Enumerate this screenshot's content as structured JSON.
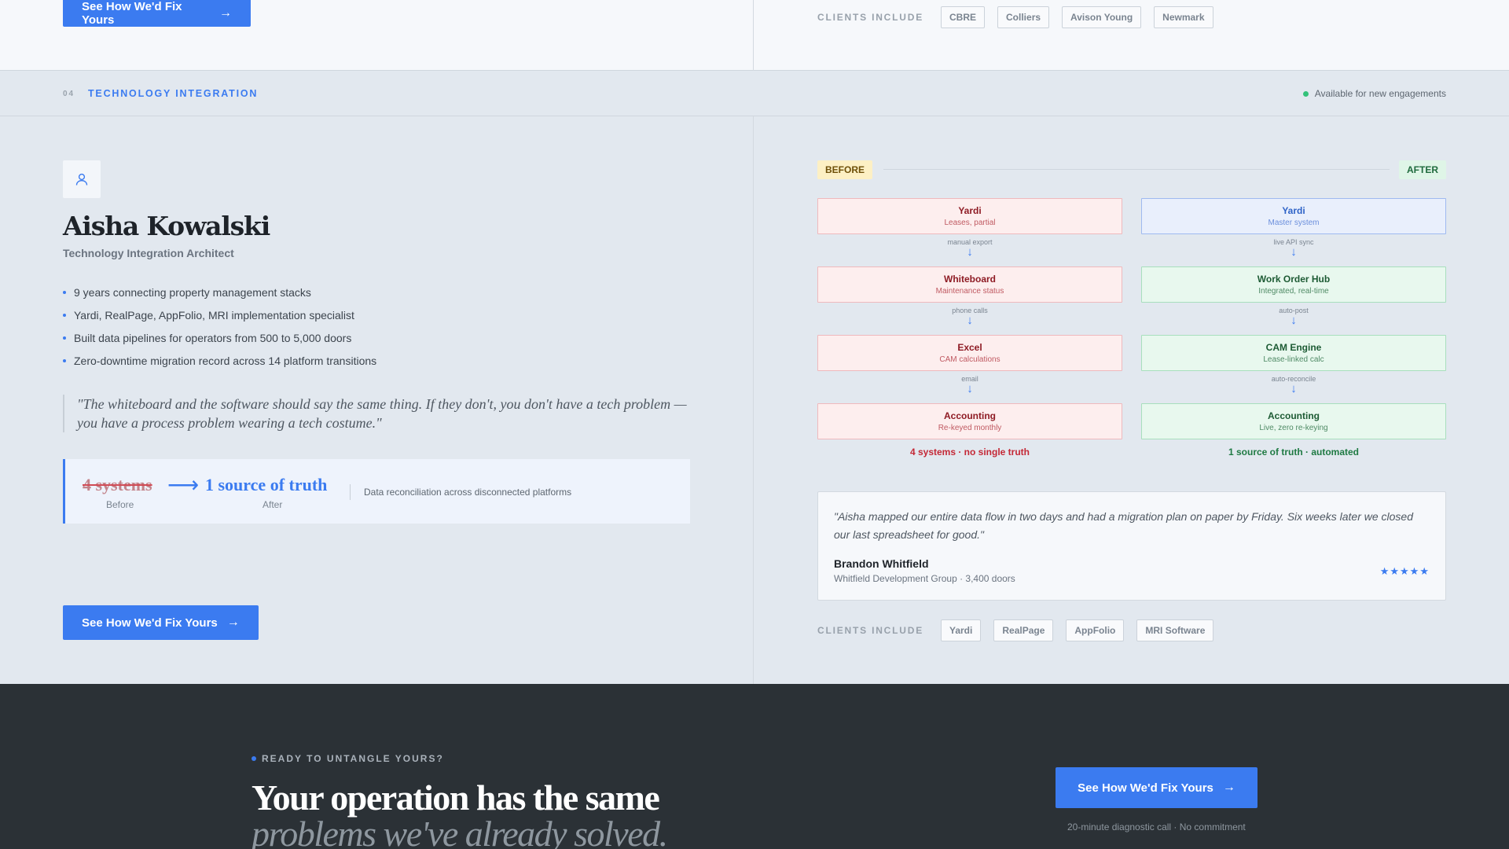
{
  "cta_label": "See How We'd Fix Yours",
  "top": {
    "clients_label": "CLIENTS INCLUDE",
    "clients": [
      "CBRE",
      "Colliers",
      "Avison Young",
      "Newmark"
    ]
  },
  "section": {
    "number": "04",
    "title": "TECHNOLOGY INTEGRATION",
    "availability": "Available for new engagements"
  },
  "profile": {
    "name": "Aisha Kowalski",
    "role": "Technology Integration Architect",
    "bullets": [
      "9 years connecting property management stacks",
      "Yardi, RealPage, AppFolio, MRI implementation specialist",
      "Built data pipelines for operators from 500 to 5,000 doors",
      "Zero-downtime migration record across 14 platform transitions"
    ],
    "quote": "\"The whiteboard and the software should say the same thing. If they don't, you don't have a tech problem — you have a process problem wearing a tech costume.\""
  },
  "metric": {
    "before": "4 systems",
    "before_label": "Before",
    "after": "1 source of truth",
    "after_label": "After",
    "description": "Data reconciliation across disconnected platforms"
  },
  "comparison": {
    "before_tag": "BEFORE",
    "after_tag": "AFTER",
    "before": {
      "boxes": [
        {
          "title": "Yardi",
          "subtitle": "Leases, partial"
        },
        {
          "title": "Whiteboard",
          "subtitle": "Maintenance status"
        },
        {
          "title": "Excel",
          "subtitle": "CAM calculations"
        },
        {
          "title": "Accounting",
          "subtitle": "Re-keyed monthly"
        }
      ],
      "links": [
        "manual export",
        "phone calls",
        "email"
      ],
      "summary": "4 systems · no single truth"
    },
    "after": {
      "boxes": [
        {
          "title": "Yardi",
          "subtitle": "Master system"
        },
        {
          "title": "Work Order Hub",
          "subtitle": "Integrated, real-time"
        },
        {
          "title": "CAM Engine",
          "subtitle": "Lease-linked calc"
        },
        {
          "title": "Accounting",
          "subtitle": "Live, zero re-keying"
        }
      ],
      "links": [
        "live API sync",
        "auto-post",
        "auto-reconcile"
      ],
      "summary": "1 source of truth · automated"
    }
  },
  "testimonial": {
    "quote": "\"Aisha mapped our entire data flow in two days and had a migration plan on paper by Friday. Six weeks later we closed our last spreadsheet for good.\"",
    "author": "Brandon Whitfield",
    "org": "Whitfield Development Group · 3,400 doors",
    "rating": 5,
    "stars": "★★★★★"
  },
  "bottom_clients": {
    "label": "CLIENTS INCLUDE",
    "clients": [
      "Yardi",
      "RealPage",
      "AppFolio",
      "MRI Software"
    ]
  },
  "footer": {
    "kicker": "READY TO UNTANGLE YOURS?",
    "headline": "Your operation has the same",
    "headline_italic": "problems we've already solved.",
    "note": "20-minute diagnostic call · No commitment"
  },
  "colors": {
    "accent": "#3b7bf0",
    "before_red": "#c42836",
    "after_green": "#1f7a43",
    "footer_bg": "#2b3136"
  }
}
